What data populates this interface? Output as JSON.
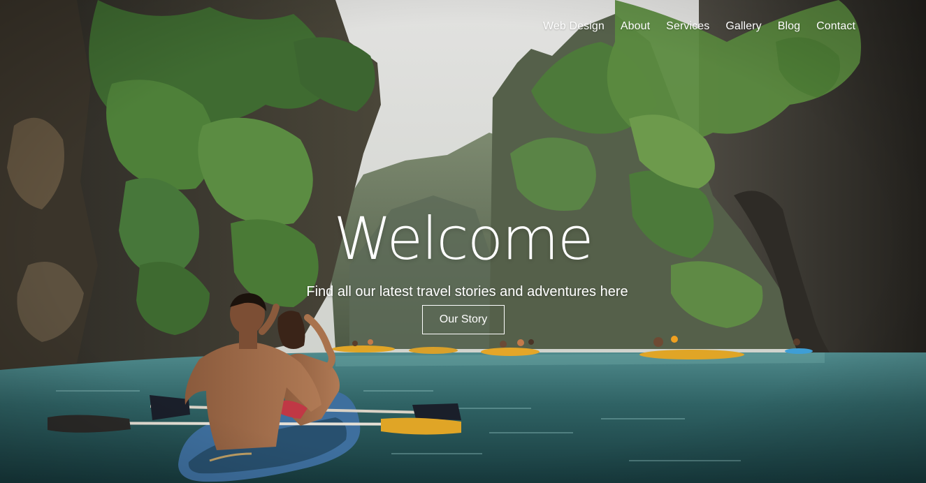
{
  "nav": {
    "items": [
      {
        "label": "Web Design"
      },
      {
        "label": "About"
      },
      {
        "label": "Services"
      },
      {
        "label": "Gallery"
      },
      {
        "label": "Blog"
      },
      {
        "label": "Contact"
      }
    ]
  },
  "hero": {
    "title": "Welcome",
    "subtitle": "Find all our latest travel stories and adventures here",
    "button_label": "Our Story",
    "image_subject": "kayakers-in-lagoon-between-limestone-cliffs"
  },
  "colors": {
    "text": "#ffffff",
    "sky": "#dcdcda",
    "water": "#2f5a5c",
    "foliage": "#3e6a32",
    "cliff": "#3a342c",
    "kayak_blue": "#3e6f9e",
    "kayak_yellow": "#e0a526"
  }
}
